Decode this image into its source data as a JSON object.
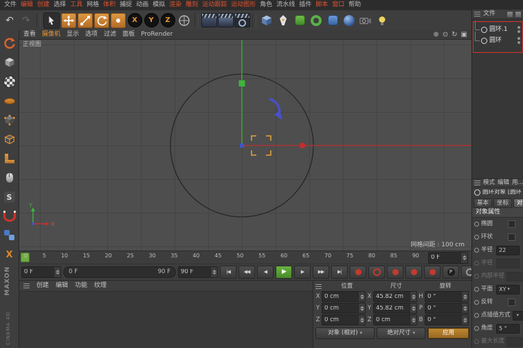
{
  "colors": {
    "accent_orange": "#e8973a",
    "hot_menu_red": "#e0512e",
    "axis_x_red": "#c03030",
    "axis_y_green": "#3db43d",
    "axis_z_blue": "#4056c8",
    "play_green": "#69b240",
    "timeline_green": "#6fae3f",
    "annotation_red": "#d8332a"
  },
  "menubar": {
    "items": [
      {
        "label": "文件",
        "hot": false
      },
      {
        "label": "编辑",
        "hot": true
      },
      {
        "label": "创建",
        "hot": true
      },
      {
        "label": "选择",
        "hot": false
      },
      {
        "label": "工具",
        "hot": true
      },
      {
        "label": "网格",
        "hot": false
      },
      {
        "label": "体积",
        "hot": true
      },
      {
        "label": "捕捉",
        "hot": false
      },
      {
        "label": "动画",
        "hot": false
      },
      {
        "label": "模拟",
        "hot": false
      },
      {
        "label": "渲染",
        "hot": true
      },
      {
        "label": "雕刻",
        "hot": true
      },
      {
        "label": "运动跟踪",
        "hot": true
      },
      {
        "label": "运动图形",
        "hot": true
      },
      {
        "label": "角色",
        "hot": false
      },
      {
        "label": "流水线",
        "hot": false
      },
      {
        "label": "插件",
        "hot": false
      },
      {
        "label": "脚本",
        "hot": true
      },
      {
        "label": "窗口",
        "hot": true
      },
      {
        "label": "帮助",
        "hot": false
      }
    ]
  },
  "toolbar": {
    "x_label": "X",
    "y_label": "Y",
    "z_label": "Z",
    "icons": [
      "undo",
      "redo",
      "live-selection",
      "move-tool",
      "scale-tool",
      "rotate-tool",
      "last-tool",
      "x-axis-lock",
      "y-axis-lock",
      "z-axis-lock",
      "coordinate-system",
      "render-view",
      "render-picture-viewer",
      "render-settings",
      "cube-primitive",
      "pen-spline",
      "subdivision-surface",
      "volume-builder",
      "bend-deformer",
      "field",
      "camera",
      "light"
    ]
  },
  "palette": {
    "icons": [
      "convert-editable",
      "model-mode",
      "texture-mode",
      "workplane-mode",
      "points-mode",
      "edges-mode",
      "polygons-mode",
      "tweak-mode",
      "soft-selection",
      "snap-magnet",
      "viewport-solo",
      "axis-mode"
    ]
  },
  "viewport": {
    "menu": [
      "查看",
      "摄像机",
      "显示",
      "选项",
      "过滤",
      "面板",
      "ProRender"
    ],
    "corner_icons": [
      "pan-view",
      "zoom-view",
      "rotate-view",
      "toggle-views"
    ],
    "view_label": "正视图",
    "grid_spacing_label": "网格间距 : 100 cm",
    "gizmo_x": "X",
    "gizmo_y": "Y"
  },
  "timeline": {
    "ticks": [
      "0",
      "5",
      "10",
      "15",
      "20",
      "25",
      "30",
      "35",
      "40",
      "45",
      "50",
      "55",
      "60",
      "65",
      "70",
      "75",
      "80",
      "85",
      "90"
    ],
    "ruler_frame": "0 F",
    "start_field": "0 F",
    "range_start": "0 F",
    "range_end": "90 F",
    "end_field": "90 F"
  },
  "transport": {
    "buttons": [
      "goto-start",
      "previous-key",
      "previous-frame",
      "play",
      "next-frame",
      "next-key",
      "goto-end"
    ],
    "record_buttons": [
      "record-keyframe",
      "autokeying",
      "record-position",
      "record-scale",
      "record-rotation",
      "record-parameter",
      "record-pla"
    ],
    "parameter_label": "P",
    "extra_buttons": [
      "keyframe-selection",
      "key-interpolation",
      "timeline-options"
    ]
  },
  "materials": {
    "menu": [
      "创建",
      "编辑",
      "功能",
      "纹理"
    ]
  },
  "coords": {
    "headers": {
      "position": "位置",
      "size": "尺寸",
      "rotation": "旋转"
    },
    "position": [
      {
        "axis": "X",
        "value": "0 cm"
      },
      {
        "axis": "Y",
        "value": "0 cm"
      },
      {
        "axis": "Z",
        "value": "0 cm"
      }
    ],
    "size": [
      {
        "axis": "X",
        "value": "45.82 cm"
      },
      {
        "axis": "Y",
        "value": "45.82 cm"
      },
      {
        "axis": "Z",
        "value": "0 cm"
      }
    ],
    "rotation": [
      {
        "axis": "H",
        "value": "0 °"
      },
      {
        "axis": "P",
        "value": "0 °"
      },
      {
        "axis": "B",
        "value": "0 °"
      }
    ],
    "mode_button": "对象 (相对)",
    "size_mode_button": "绝对尺寸",
    "apply_button": "应用"
  },
  "object_manager": {
    "menu_label": "文件",
    "objects": [
      {
        "name": "圆环.1"
      },
      {
        "name": "圆环"
      }
    ]
  },
  "attributes": {
    "menu": [
      "模式",
      "编辑",
      "用..."
    ],
    "object_title": "圆环对象 [圆环...",
    "tabs": [
      "基本",
      "坐标",
      "对象"
    ],
    "active_tab": "对象",
    "section_title": "对象属性",
    "rows": [
      {
        "label": "椭圆",
        "type": "checkbox",
        "value": ""
      },
      {
        "label": "环状",
        "type": "checkbox",
        "value": ""
      },
      {
        "label": "半径",
        "type": "input",
        "value": "22"
      },
      {
        "label": "半径",
        "type": "input",
        "value": "",
        "disabled": true
      },
      {
        "label": "内部半径",
        "type": "input",
        "value": "",
        "disabled": true
      },
      {
        "label": "平面",
        "type": "dropdown",
        "value": "XY"
      },
      {
        "label": "反转",
        "type": "checkbox",
        "value": ""
      },
      {
        "label": "点插值方式",
        "type": "dropdown",
        "value": ""
      },
      {
        "label": "角度",
        "type": "input",
        "value": "5 °"
      },
      {
        "label": "最大长度",
        "type": "input",
        "value": "",
        "disabled": true
      }
    ]
  },
  "branding": {
    "line1": "MAXON",
    "line2": "CINEMA 4D"
  }
}
